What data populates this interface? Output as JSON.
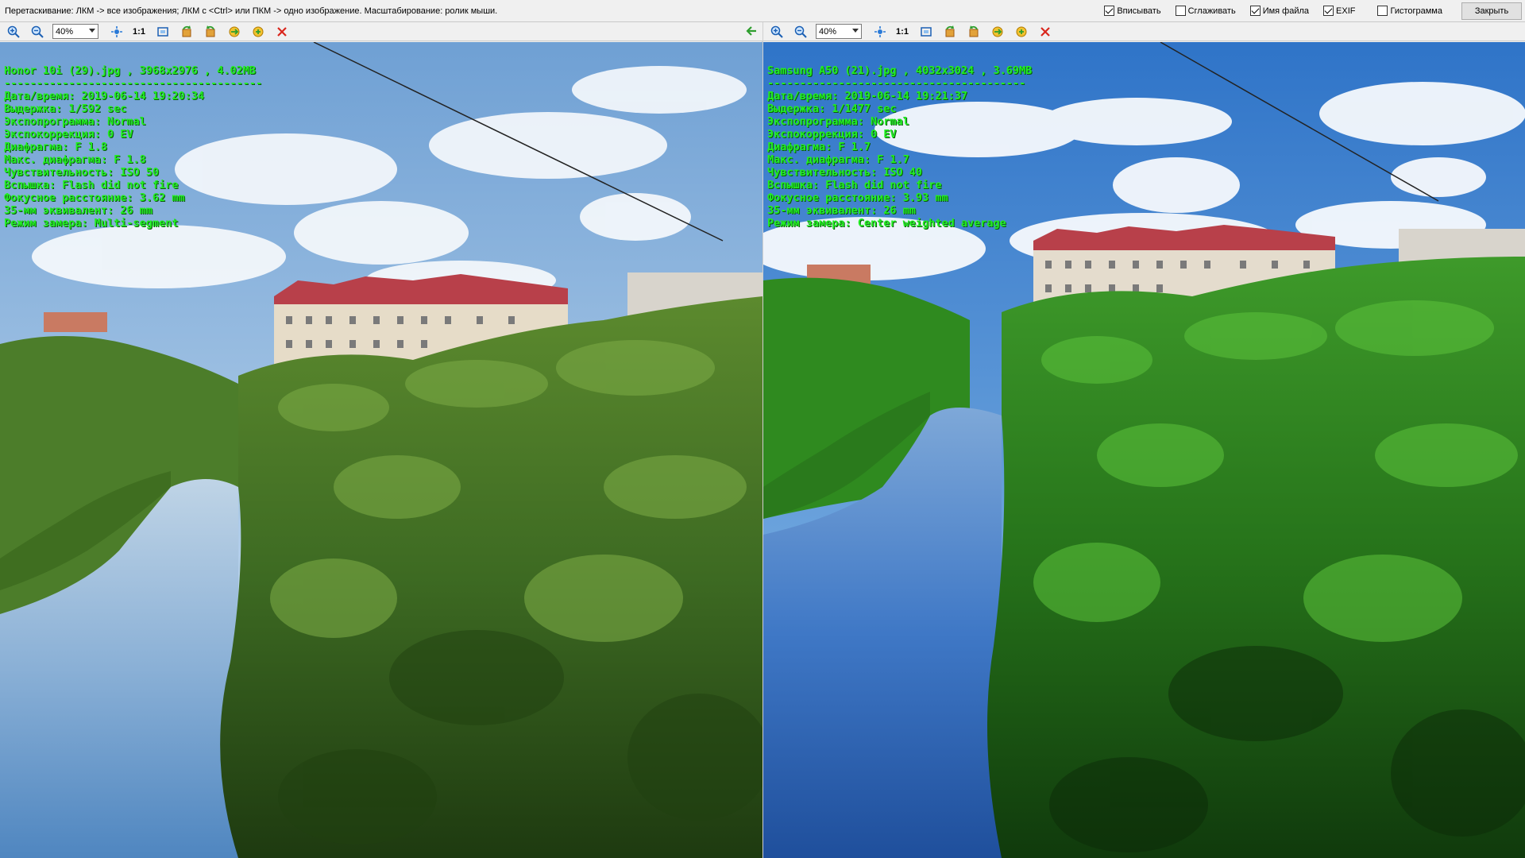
{
  "hint": "Перетаскивание: ЛКМ -> все изображения; ЛКМ с <Ctrl> или ПКМ -> одно изображение. Масштабирование: ролик мыши.",
  "options": [
    {
      "label": "Вписывать",
      "checked": true
    },
    {
      "label": "Сглаживать",
      "checked": false
    },
    {
      "label": "Имя файла",
      "checked": true
    },
    {
      "label": "EXIF",
      "checked": true
    },
    {
      "label": "Гистограмма",
      "checked": false
    }
  ],
  "close_label": "Закрыть",
  "left": {
    "zoom": "40%",
    "one_to_one": "1:1",
    "exif": {
      "file": "Honor 10i (29).jpg , 3968x2976 , 4.02MB",
      "separator": "----------------------------------------",
      "datetime": "Дата/время: 2019-06-14 19:20:34",
      "exposure": "Выдержка: 1/592 sec",
      "program": "Экспопрограмма: Normal",
      "ev": "Экспокоррекция: 0 EV",
      "aperture": "Диафрагма: F 1.8",
      "max_aperture": "Макс. диафрагма: F 1.8",
      "iso": "Чувствительность: ISO 50",
      "flash": "Вспышка: Flash did not fire",
      "focal": "Фокусное расстояние: 3.62 mm",
      "eq35": "35-мм эквивалент: 26 mm",
      "metering": "Режим замера: Multi-segment"
    }
  },
  "right": {
    "zoom": "40%",
    "one_to_one": "1:1",
    "exif": {
      "file": "Samsung A50 (21).jpg , 4032x3024 , 3.69MB",
      "separator": "----------------------------------------",
      "datetime": "Дата/время: 2019-06-14 19:21:37",
      "exposure": "Выдержка: 1/1477 sec",
      "program": "Экспопрограмма: Normal",
      "ev": "Экспокоррекция: 0 EV",
      "aperture": "Диафрагма: F 1.7",
      "max_aperture": "Макс. диафрагма: F 1.7",
      "iso": "Чувствительность: ISO 40",
      "flash": "Вспышка: Flash did not fire",
      "focal": "Фокусное расстояние: 3.93 mm",
      "eq35": "35-мм эквивалент: 26 mm",
      "metering": "Режим замера: Center weighted average"
    }
  },
  "icons": [
    "zoom-in-icon",
    "zoom-out-icon",
    "fit-icon",
    "actual-size-icon",
    "fullscreen-icon",
    "rotate-left-icon",
    "rotate-right-icon",
    "flip-icon",
    "save-icon",
    "close-icon",
    "sync-arrow-icon"
  ],
  "colors": {
    "exif_text": "#22ee22",
    "close_x": "#d9261c",
    "accent_green": "#2e9e2e"
  }
}
